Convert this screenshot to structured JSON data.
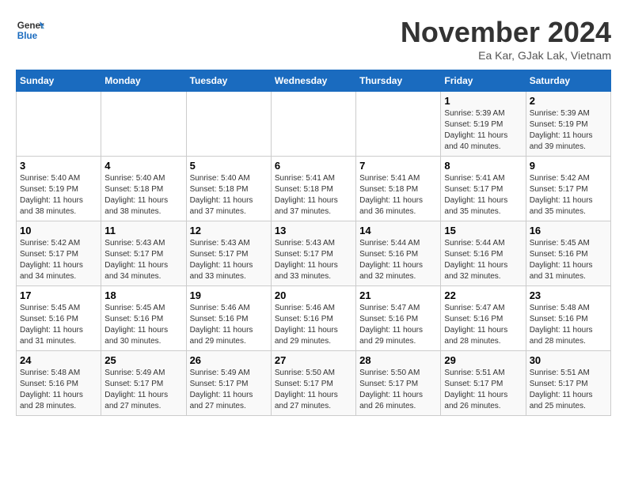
{
  "header": {
    "logo_line1": "General",
    "logo_line2": "Blue",
    "month_title": "November 2024",
    "location": "Ea Kar, GJak Lak, Vietnam"
  },
  "days_of_week": [
    "Sunday",
    "Monday",
    "Tuesday",
    "Wednesday",
    "Thursday",
    "Friday",
    "Saturday"
  ],
  "weeks": [
    [
      {
        "day": "",
        "info": ""
      },
      {
        "day": "",
        "info": ""
      },
      {
        "day": "",
        "info": ""
      },
      {
        "day": "",
        "info": ""
      },
      {
        "day": "",
        "info": ""
      },
      {
        "day": "1",
        "info": "Sunrise: 5:39 AM\nSunset: 5:19 PM\nDaylight: 11 hours and 40 minutes."
      },
      {
        "day": "2",
        "info": "Sunrise: 5:39 AM\nSunset: 5:19 PM\nDaylight: 11 hours and 39 minutes."
      }
    ],
    [
      {
        "day": "3",
        "info": "Sunrise: 5:40 AM\nSunset: 5:19 PM\nDaylight: 11 hours and 38 minutes."
      },
      {
        "day": "4",
        "info": "Sunrise: 5:40 AM\nSunset: 5:18 PM\nDaylight: 11 hours and 38 minutes."
      },
      {
        "day": "5",
        "info": "Sunrise: 5:40 AM\nSunset: 5:18 PM\nDaylight: 11 hours and 37 minutes."
      },
      {
        "day": "6",
        "info": "Sunrise: 5:41 AM\nSunset: 5:18 PM\nDaylight: 11 hours and 37 minutes."
      },
      {
        "day": "7",
        "info": "Sunrise: 5:41 AM\nSunset: 5:18 PM\nDaylight: 11 hours and 36 minutes."
      },
      {
        "day": "8",
        "info": "Sunrise: 5:41 AM\nSunset: 5:17 PM\nDaylight: 11 hours and 35 minutes."
      },
      {
        "day": "9",
        "info": "Sunrise: 5:42 AM\nSunset: 5:17 PM\nDaylight: 11 hours and 35 minutes."
      }
    ],
    [
      {
        "day": "10",
        "info": "Sunrise: 5:42 AM\nSunset: 5:17 PM\nDaylight: 11 hours and 34 minutes."
      },
      {
        "day": "11",
        "info": "Sunrise: 5:43 AM\nSunset: 5:17 PM\nDaylight: 11 hours and 34 minutes."
      },
      {
        "day": "12",
        "info": "Sunrise: 5:43 AM\nSunset: 5:17 PM\nDaylight: 11 hours and 33 minutes."
      },
      {
        "day": "13",
        "info": "Sunrise: 5:43 AM\nSunset: 5:17 PM\nDaylight: 11 hours and 33 minutes."
      },
      {
        "day": "14",
        "info": "Sunrise: 5:44 AM\nSunset: 5:16 PM\nDaylight: 11 hours and 32 minutes."
      },
      {
        "day": "15",
        "info": "Sunrise: 5:44 AM\nSunset: 5:16 PM\nDaylight: 11 hours and 32 minutes."
      },
      {
        "day": "16",
        "info": "Sunrise: 5:45 AM\nSunset: 5:16 PM\nDaylight: 11 hours and 31 minutes."
      }
    ],
    [
      {
        "day": "17",
        "info": "Sunrise: 5:45 AM\nSunset: 5:16 PM\nDaylight: 11 hours and 31 minutes."
      },
      {
        "day": "18",
        "info": "Sunrise: 5:45 AM\nSunset: 5:16 PM\nDaylight: 11 hours and 30 minutes."
      },
      {
        "day": "19",
        "info": "Sunrise: 5:46 AM\nSunset: 5:16 PM\nDaylight: 11 hours and 29 minutes."
      },
      {
        "day": "20",
        "info": "Sunrise: 5:46 AM\nSunset: 5:16 PM\nDaylight: 11 hours and 29 minutes."
      },
      {
        "day": "21",
        "info": "Sunrise: 5:47 AM\nSunset: 5:16 PM\nDaylight: 11 hours and 29 minutes."
      },
      {
        "day": "22",
        "info": "Sunrise: 5:47 AM\nSunset: 5:16 PM\nDaylight: 11 hours and 28 minutes."
      },
      {
        "day": "23",
        "info": "Sunrise: 5:48 AM\nSunset: 5:16 PM\nDaylight: 11 hours and 28 minutes."
      }
    ],
    [
      {
        "day": "24",
        "info": "Sunrise: 5:48 AM\nSunset: 5:16 PM\nDaylight: 11 hours and 28 minutes."
      },
      {
        "day": "25",
        "info": "Sunrise: 5:49 AM\nSunset: 5:17 PM\nDaylight: 11 hours and 27 minutes."
      },
      {
        "day": "26",
        "info": "Sunrise: 5:49 AM\nSunset: 5:17 PM\nDaylight: 11 hours and 27 minutes."
      },
      {
        "day": "27",
        "info": "Sunrise: 5:50 AM\nSunset: 5:17 PM\nDaylight: 11 hours and 27 minutes."
      },
      {
        "day": "28",
        "info": "Sunrise: 5:50 AM\nSunset: 5:17 PM\nDaylight: 11 hours and 26 minutes."
      },
      {
        "day": "29",
        "info": "Sunrise: 5:51 AM\nSunset: 5:17 PM\nDaylight: 11 hours and 26 minutes."
      },
      {
        "day": "30",
        "info": "Sunrise: 5:51 AM\nSunset: 5:17 PM\nDaylight: 11 hours and 25 minutes."
      }
    ]
  ]
}
